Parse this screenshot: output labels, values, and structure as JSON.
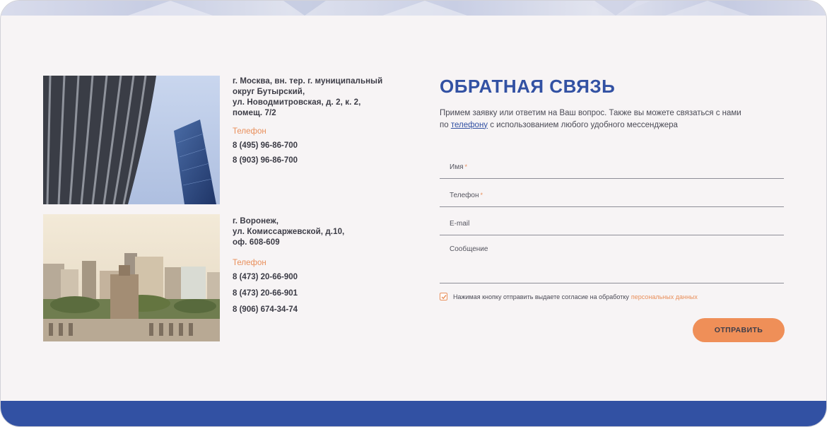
{
  "offices": [
    {
      "address": "г. Москва, вн. тер. г. муниципальный\nокруг Бутырский,\nул. Новодмитровская, д. 2, к. 2,\nпомещ. 7/2",
      "phone_label": "Телефон",
      "phones": [
        "8 (495) 96-86-700",
        "8 (903) 96-86-700"
      ]
    },
    {
      "address": "г. Воронеж,\nул. Комиссаржевской, д.10,\nоф. 608-609",
      "phone_label": "Телефон",
      "phones": [
        "8 (473) 20-66-900",
        "8 (473) 20-66-901",
        "8 (906) 674-34-74"
      ]
    }
  ],
  "feedback": {
    "title": "ОБРАТНАЯ СВЯЗЬ",
    "desc_before": "Примем заявку или ответим на Ваш вопрос. Также вы можете связаться с нами по ",
    "desc_link": "телефону",
    "desc_after": " с использованием любого удобного мессенджера",
    "fields": {
      "name": "Имя",
      "phone": "Телефон",
      "email": "E-mail",
      "message": "Сообщение"
    },
    "required_mark": "*",
    "consent_text": "Нажимая кнопку отправить выдаете согласие на обработку",
    "consent_link": "персональных данных",
    "consent_checked": true,
    "submit": "ОТПРАВИТЬ"
  },
  "colors": {
    "accent": "#3251a3",
    "orange": "#ef8f58",
    "background": "#f7f4f5"
  }
}
